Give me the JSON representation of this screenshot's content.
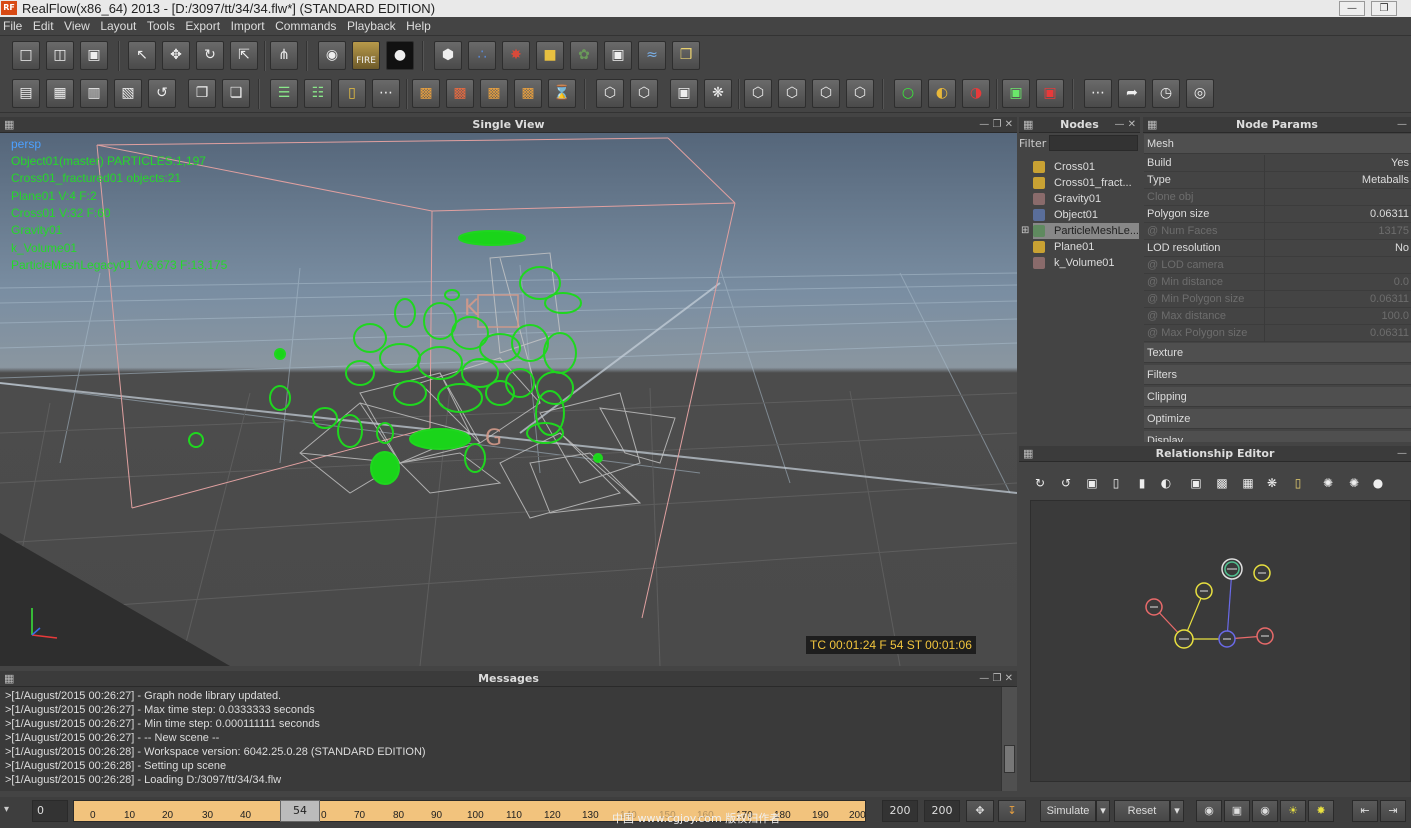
{
  "window": {
    "title": "RealFlow(x86_64) 2013 - [D:/3097/tt/34/34.flw*] (STANDARD EDITION)",
    "logo": "RF"
  },
  "menu": [
    "File",
    "Edit",
    "View",
    "Layout",
    "Tools",
    "Export",
    "Import",
    "Commands",
    "Playback",
    "Help"
  ],
  "toolbar": {
    "fire_label": "FIRE"
  },
  "viewport": {
    "title": "Single View",
    "hud": [
      "persp",
      "Object01(master) PARTICLES:1,197",
      "Cross01_fractured01 objects:21",
      "Plane01 V:4 F:2",
      "Cross01 V:32 F:60",
      "Gravity01",
      "k_Volume01",
      "ParticleMeshLegacy01 V:6,673 F:13,175"
    ],
    "timecode": "TC 00:01:24   F 54   ST 00:01:06",
    "colors": {
      "hud_text": "#26d82a",
      "persp_label": "#4ca0ff",
      "timecode": "#f2c53d"
    }
  },
  "nodes_panel": {
    "title": "Nodes",
    "filter_label": "Filter",
    "filter_value": "",
    "items": [
      {
        "label": "Cross01",
        "icon": "cube-icon",
        "color": "#c9a233"
      },
      {
        "label": "Cross01_fract...",
        "icon": "cube-icon",
        "color": "#c9a233"
      },
      {
        "label": "Gravity01",
        "icon": "daemon-icon",
        "color": "#8a6b6b"
      },
      {
        "label": "Object01",
        "icon": "emitter-icon",
        "color": "#5a6e9a"
      },
      {
        "label": "ParticleMeshLe...",
        "icon": "mesh-icon",
        "color": "#5f8a5f"
      },
      {
        "label": "Plane01",
        "icon": "cube-icon",
        "color": "#c9a233"
      },
      {
        "label": "k_Volume01",
        "icon": "daemon-icon",
        "color": "#8a6b6b"
      }
    ],
    "selected_index": 4
  },
  "params_panel": {
    "title": "Node Params",
    "section_mesh": "Mesh",
    "rows": [
      {
        "label": "Build",
        "value": "Yes",
        "disabled": false
      },
      {
        "label": "Type",
        "value": "Metaballs",
        "disabled": false
      },
      {
        "label": "Clone obj",
        "value": "",
        "disabled": true
      },
      {
        "label": "Polygon size",
        "value": "0.06311",
        "disabled": false
      },
      {
        "label": "@ Num Faces",
        "value": "13175",
        "disabled": true
      },
      {
        "label": "LOD resolution",
        "value": "No",
        "disabled": false
      },
      {
        "label": "@ LOD camera",
        "value": "",
        "disabled": true
      },
      {
        "label": "@ Min distance",
        "value": "0.0",
        "disabled": true
      },
      {
        "label": "@ Min Polygon size",
        "value": "0.06311",
        "disabled": true
      },
      {
        "label": "@ Max distance",
        "value": "100.0",
        "disabled": true
      },
      {
        "label": "@ Max Polygon size",
        "value": "0.06311",
        "disabled": true
      }
    ],
    "sections": [
      "Texture",
      "Filters",
      "Clipping",
      "Optimize",
      "Display"
    ]
  },
  "relationship": {
    "title": "Relationship Editor"
  },
  "messages": {
    "title": "Messages",
    "lines": [
      ">[1/August/2015 00:26:27] - Graph node library updated.",
      ">[1/August/2015 00:26:27] - Max time step: 0.0333333 seconds",
      ">[1/August/2015 00:26:27] - Min time step: 0.000111111 seconds",
      ">[1/August/2015 00:26:27] - -- New scene --",
      ">[1/August/2015 00:26:28] - Workspace version: 6042.25.0.28 (STANDARD EDITION)",
      ">[1/August/2015 00:26:28] - Setting up scene",
      ">[1/August/2015 00:26:28] -  Loading D:/3097/tt/34/34.flw"
    ]
  },
  "timeline": {
    "start_frame": "0",
    "current_frame": "54",
    "ticks": [
      "0",
      "10",
      "20",
      "30",
      "40",
      "0",
      "70",
      "80",
      "90",
      "100",
      "110",
      "120",
      "130",
      "140",
      "150",
      "160",
      "170",
      "180",
      "190",
      "200"
    ],
    "end_frame": "200",
    "max_frame": "200",
    "simulate_label": "Simulate",
    "reset_label": "Reset",
    "watermark": "中国 www.cgjoy.com 版权归作者"
  }
}
